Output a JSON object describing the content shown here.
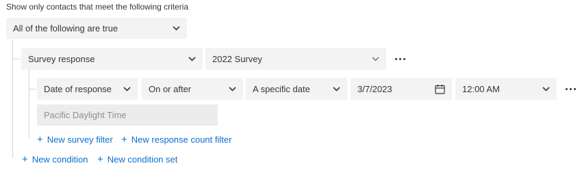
{
  "header": {
    "text": "Show only contacts that meet the following criteria"
  },
  "condition_logic": {
    "value": "All of the following are true"
  },
  "condition": {
    "field": "Survey response",
    "survey": "2022 Survey"
  },
  "filter": {
    "field": "Date of response",
    "operator": "On or after",
    "date_type": "A specific date",
    "date": "3/7/2023",
    "time": "12:00 AM",
    "timezone": "Pacific Daylight Time"
  },
  "links": {
    "new_survey_filter": "New survey filter",
    "new_response_count_filter": "New response count filter",
    "new_condition": "New condition",
    "new_condition_set": "New condition set"
  },
  "colors": {
    "link": "#0b6ed0",
    "field_bg": "#f3f3f3",
    "text": "#32363a"
  },
  "icons": [
    "chevron-down-icon",
    "more-options-icon",
    "calendar-icon",
    "plus-icon"
  ]
}
